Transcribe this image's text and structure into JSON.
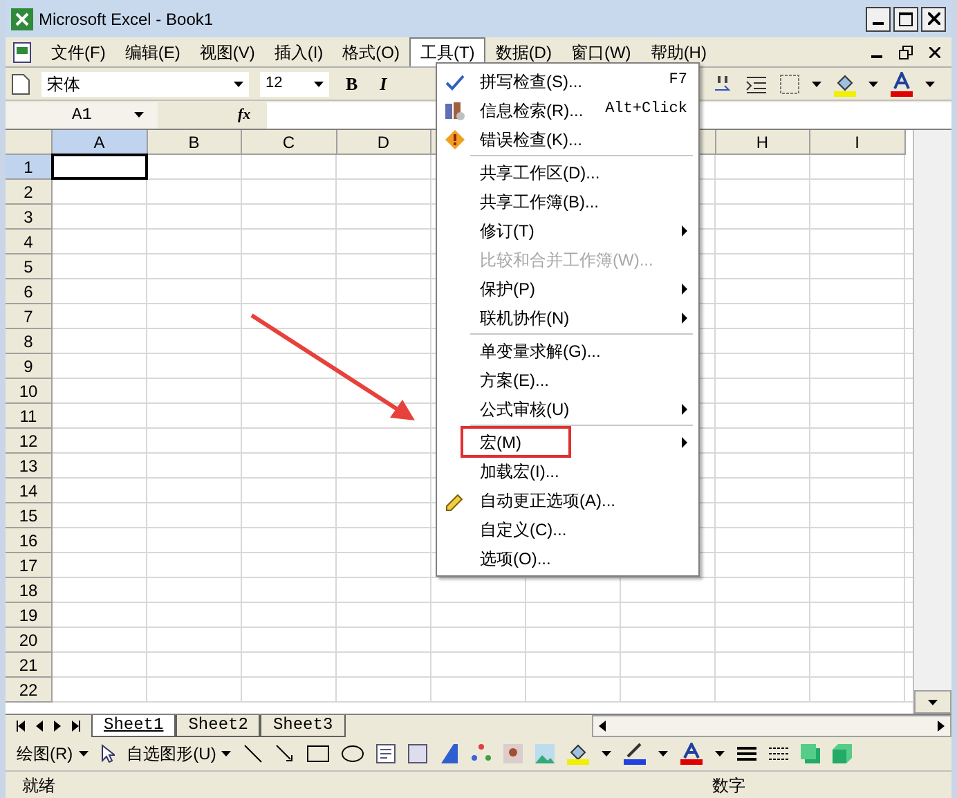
{
  "window": {
    "title": "Microsoft Excel - Book1"
  },
  "menu_bar": [
    {
      "label": "文件(F)",
      "selected": false
    },
    {
      "label": "编辑(E)",
      "selected": false
    },
    {
      "label": "视图(V)",
      "selected": false
    },
    {
      "label": "插入(I)",
      "selected": false
    },
    {
      "label": "格式(O)",
      "selected": false
    },
    {
      "label": "工具(T)",
      "selected": true
    },
    {
      "label": "数据(D)",
      "selected": false
    },
    {
      "label": "窗口(W)",
      "selected": false
    },
    {
      "label": "帮助(H)",
      "selected": false
    }
  ],
  "toolbar": {
    "font_name": "宋体",
    "font_size": "12",
    "bold": "B",
    "italic": "I"
  },
  "formula_bar": {
    "name_box": "A1",
    "fx": "fx"
  },
  "sheet": {
    "columns": [
      {
        "label": "A",
        "selected": true
      },
      {
        "label": "B",
        "selected": false
      },
      {
        "label": "C",
        "selected": false
      },
      {
        "label": "D",
        "selected": false
      },
      {
        "label": "H",
        "selected": false
      },
      {
        "label": "I",
        "selected": false
      }
    ],
    "rows": [
      {
        "label": "1",
        "selected": true
      },
      {
        "label": "2",
        "selected": false
      },
      {
        "label": "3",
        "selected": false
      },
      {
        "label": "4",
        "selected": false
      },
      {
        "label": "5",
        "selected": false
      },
      {
        "label": "6",
        "selected": false
      },
      {
        "label": "7",
        "selected": false
      },
      {
        "label": "8",
        "selected": false
      },
      {
        "label": "9",
        "selected": false
      },
      {
        "label": "10",
        "selected": false
      },
      {
        "label": "11",
        "selected": false
      },
      {
        "label": "12",
        "selected": false
      },
      {
        "label": "13",
        "selected": false
      },
      {
        "label": "14",
        "selected": false
      },
      {
        "label": "15",
        "selected": false
      },
      {
        "label": "16",
        "selected": false
      },
      {
        "label": "17",
        "selected": false
      },
      {
        "label": "18",
        "selected": false
      },
      {
        "label": "19",
        "selected": false
      },
      {
        "label": "20",
        "selected": false
      },
      {
        "label": "21",
        "selected": false
      },
      {
        "label": "22",
        "selected": false
      }
    ]
  },
  "tools_menu": [
    {
      "label": "拼写检查(S)...",
      "shortcut": "F7",
      "separator_before": false,
      "disabled": false,
      "submenu": false,
      "highlighted": false
    },
    {
      "label": "信息检索(R)...",
      "shortcut": "Alt+Click",
      "separator_before": false,
      "disabled": false,
      "submenu": false,
      "highlighted": false
    },
    {
      "label": "错误检查(K)...",
      "separator_before": false,
      "disabled": false,
      "submenu": false,
      "highlighted": false
    },
    {
      "label": "共享工作区(D)...",
      "separator_before": true,
      "disabled": false,
      "submenu": false,
      "highlighted": false
    },
    {
      "label": "共享工作簿(B)...",
      "separator_before": false,
      "disabled": false,
      "submenu": false,
      "highlighted": false
    },
    {
      "label": "修订(T)",
      "separator_before": false,
      "disabled": false,
      "submenu": true,
      "highlighted": false
    },
    {
      "label": "比较和合并工作簿(W)...",
      "separator_before": false,
      "disabled": true,
      "submenu": false,
      "highlighted": false
    },
    {
      "label": "保护(P)",
      "separator_before": false,
      "disabled": false,
      "submenu": true,
      "highlighted": false
    },
    {
      "label": "联机协作(N)",
      "separator_before": false,
      "disabled": false,
      "submenu": true,
      "highlighted": false
    },
    {
      "label": "单变量求解(G)...",
      "separator_before": true,
      "disabled": false,
      "submenu": false,
      "highlighted": false
    },
    {
      "label": "方案(E)...",
      "separator_before": false,
      "disabled": false,
      "submenu": false,
      "highlighted": false
    },
    {
      "label": "公式审核(U)",
      "separator_before": false,
      "disabled": false,
      "submenu": true,
      "highlighted": false
    },
    {
      "label": "宏(M)",
      "separator_before": true,
      "disabled": false,
      "submenu": true,
      "highlighted": true
    },
    {
      "label": "加载宏(I)...",
      "separator_before": false,
      "disabled": false,
      "submenu": false,
      "highlighted": false
    },
    {
      "label": "自动更正选项(A)...",
      "separator_before": false,
      "disabled": false,
      "submenu": false,
      "highlighted": false
    },
    {
      "label": "自定义(C)...",
      "separator_before": false,
      "disabled": false,
      "submenu": false,
      "highlighted": false
    },
    {
      "label": "选项(O)...",
      "separator_before": false,
      "disabled": false,
      "submenu": false,
      "highlighted": false
    }
  ],
  "sheet_tabs": [
    {
      "label": "Sheet1",
      "selected": true
    },
    {
      "label": "Sheet2",
      "selected": false
    },
    {
      "label": "Sheet3",
      "selected": false
    }
  ],
  "drawing_toolbar": {
    "draw": "绘图(R)",
    "autoshapes": "自选图形(U)"
  },
  "status_bar": {
    "left": "就绪",
    "right": "数字"
  }
}
